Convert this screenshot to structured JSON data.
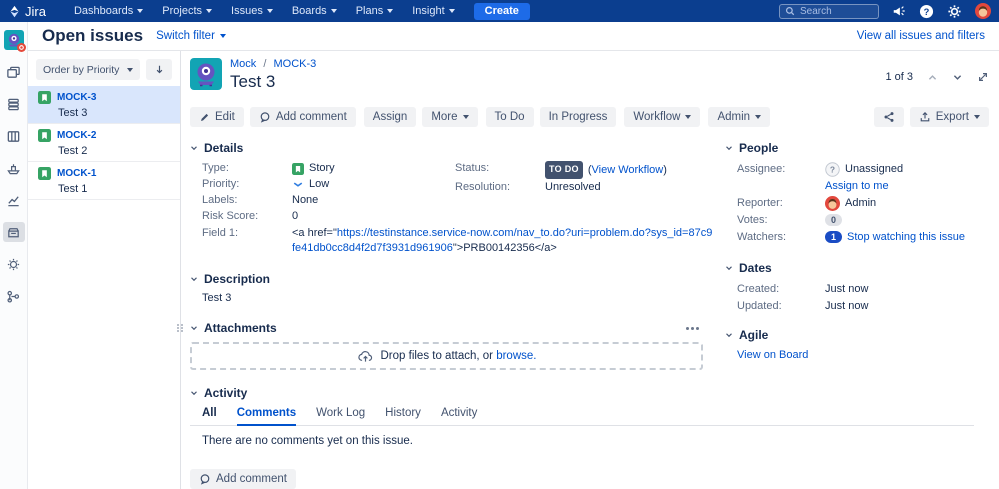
{
  "nav": {
    "logo_text": "Jira",
    "items": [
      "Dashboards",
      "Projects",
      "Issues",
      "Boards",
      "Plans",
      "Insight"
    ],
    "create_label": "Create",
    "search_placeholder": "Search"
  },
  "page_header": {
    "title": "Open issues",
    "switch_filter_label": "Switch filter",
    "view_all_link": "View all issues and filters"
  },
  "issue_list": {
    "order_by_label": "Order by Priority",
    "items": [
      {
        "key": "MOCK-3",
        "summary": "Test 3"
      },
      {
        "key": "MOCK-2",
        "summary": "Test 2"
      },
      {
        "key": "MOCK-1",
        "summary": "Test 1"
      }
    ]
  },
  "issue": {
    "breadcrumb": {
      "project": "Mock",
      "separator": "/",
      "key": "MOCK-3"
    },
    "title": "Test 3",
    "pager_count": "1 of 3",
    "toolbar": {
      "edit": "Edit",
      "add_comment": "Add comment",
      "assign": "Assign",
      "more": "More",
      "todo": "To Do",
      "in_progress": "In Progress",
      "workflow": "Workflow",
      "admin": "Admin",
      "export": "Export"
    },
    "details": {
      "heading": "Details",
      "type_label": "Type:",
      "type_value": "Story",
      "priority_label": "Priority:",
      "priority_value": "Low",
      "labels_label": "Labels:",
      "labels_value": "None",
      "risk_label": "Risk Score:",
      "risk_value": "0",
      "field1_label": "Field 1:",
      "field1_prefix": "<a href=\"",
      "field1_url": "https://testinstance.service-now.com/nav_to.do?uri=problem.do?sys_id=87c9fe41db0cc8d4f2d7f3931d961906",
      "field1_suffix": "\">PRB00142356</a>",
      "status_label": "Status:",
      "status_value": "TO DO",
      "status_paren_open": "(",
      "status_link": "View Workflow",
      "status_paren_close": ")",
      "resolution_label": "Resolution:",
      "resolution_value": "Unresolved"
    },
    "description": {
      "heading": "Description",
      "text": "Test 3"
    },
    "attachments": {
      "heading": "Attachments",
      "drop_text": "Drop files to attach, or",
      "browse_link": "browse."
    },
    "activity": {
      "heading": "Activity",
      "tabs": [
        "All",
        "Comments",
        "Work Log",
        "History",
        "Activity"
      ],
      "active_tab": "Comments",
      "empty_message": "There are no comments yet on this issue.",
      "add_comment_label": "Add comment"
    }
  },
  "sidebar": {
    "people": {
      "heading": "People",
      "assignee_label": "Assignee:",
      "assignee_value": "Unassigned",
      "assign_to_me_link": "Assign to me",
      "reporter_label": "Reporter:",
      "reporter_value": "Admin",
      "votes_label": "Votes:",
      "votes_value": "0",
      "watchers_label": "Watchers:",
      "watchers_count": "1",
      "watchers_link": "Stop watching this issue"
    },
    "dates": {
      "heading": "Dates",
      "created_label": "Created:",
      "created_value": "Just now",
      "updated_label": "Updated:",
      "updated_value": "Just now"
    },
    "agile": {
      "heading": "Agile",
      "link": "View on Board"
    }
  },
  "colors": {
    "nav_bg": "#0B3E8F",
    "create_button": "#1D6BE8",
    "link_blue": "#0052CC",
    "story_green": "#36A364",
    "status_lozenge_bg": "#42526E",
    "selected_row_bg": "#D9E6FC",
    "watchers_badge": "#1A4CC4",
    "reporter_avatar": "#E2483D"
  }
}
